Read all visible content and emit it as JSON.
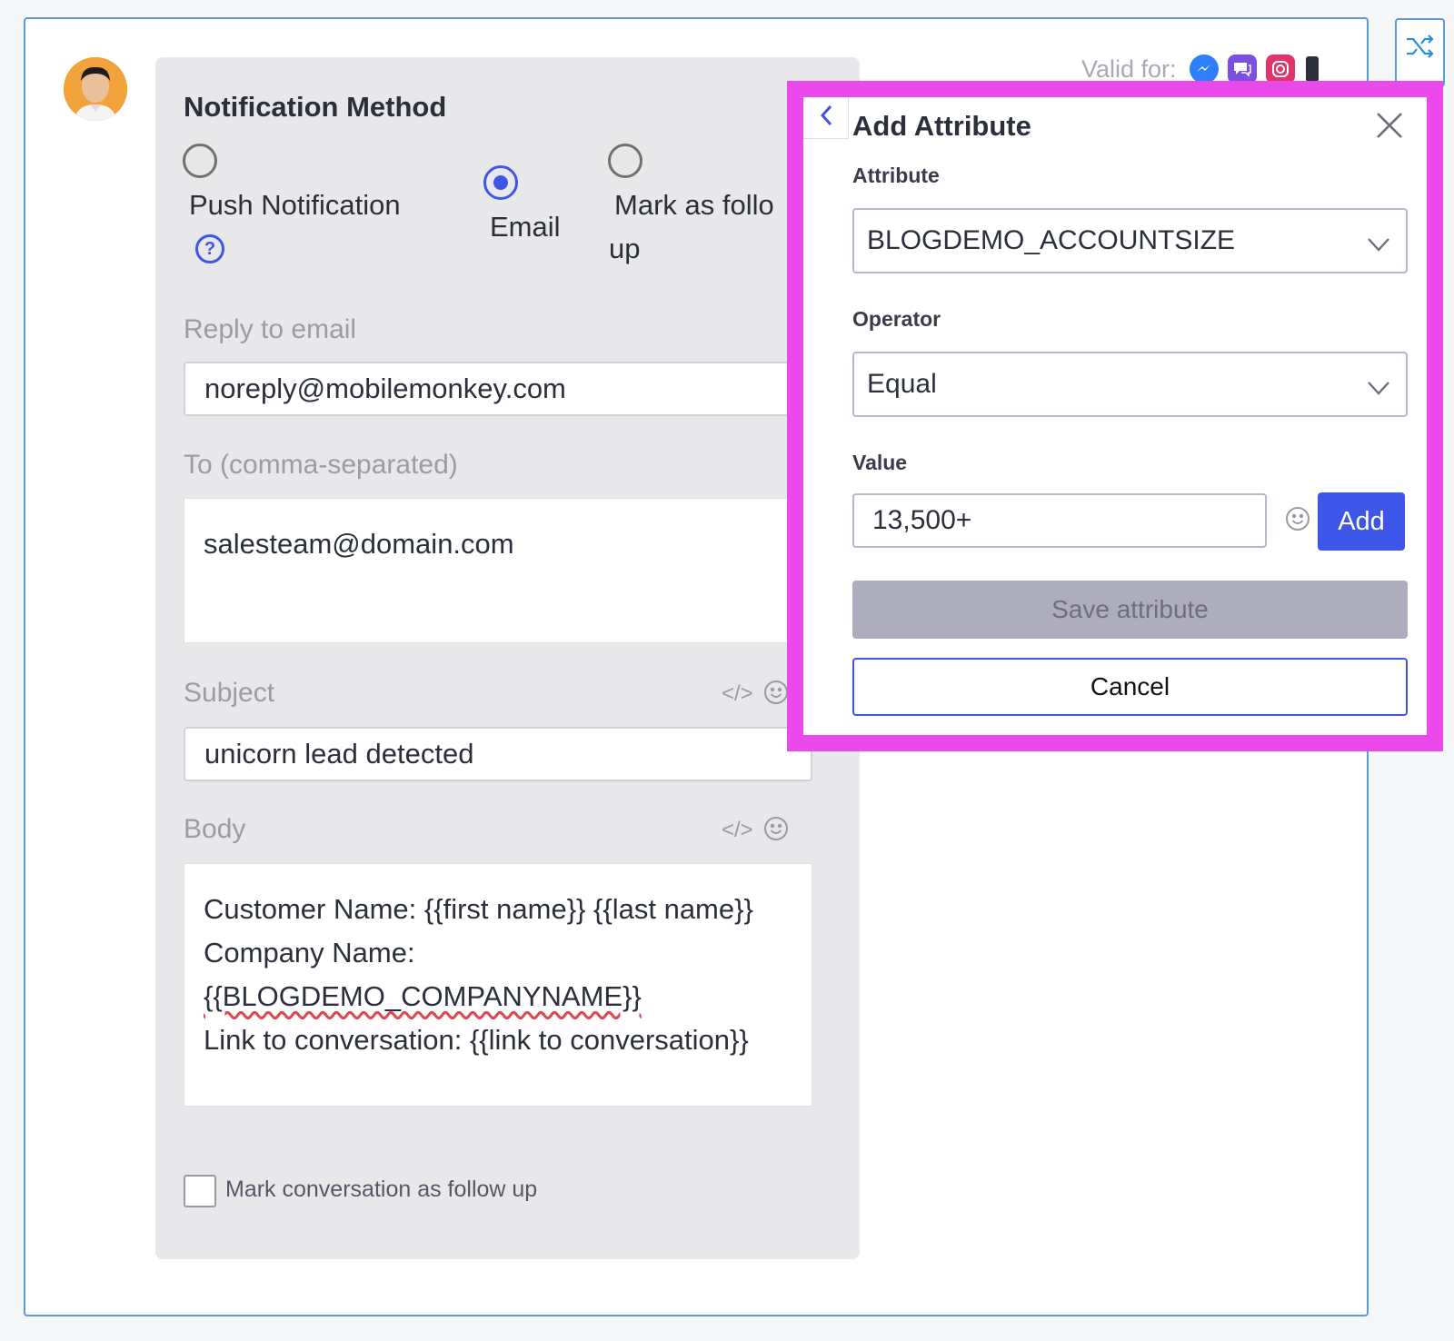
{
  "valid_for": {
    "label": "Valid for:",
    "channels": [
      "messenger-icon",
      "chat-icon",
      "instagram-icon",
      "phone-icon"
    ]
  },
  "notification": {
    "title": "Notification Method",
    "options": [
      {
        "label": "Push Notification",
        "checked": false
      },
      {
        "label": "Email",
        "checked": true
      },
      {
        "label_line1": "Mark as follo",
        "label_line2": "up",
        "checked": false
      }
    ]
  },
  "reply_to": {
    "label": "Reply to email",
    "value": "noreply@mobilemonkey.com"
  },
  "to": {
    "label": "To (comma-separated)",
    "value": "salesteam@domain.com"
  },
  "subject": {
    "label": "Subject",
    "value": "unicorn lead detected"
  },
  "body": {
    "label": "Body",
    "lines": [
      "Customer Name: {{first name}} {{last name}}",
      "Company Name:",
      "{{BLOGDEMO_COMPANYNAME}}",
      "Link to conversation: {{link to conversation}}"
    ],
    "code_icon": "</>"
  },
  "follow_up": {
    "label": "Mark conversation as follow up",
    "checked": false
  },
  "modal": {
    "title": "Add Attribute",
    "attribute_label": "Attribute",
    "attribute_value": "BLOGDEMO_ACCOUNTSIZE",
    "operator_label": "Operator",
    "operator_value": "Equal",
    "value_label": "Value",
    "value_input": "13,500+",
    "add_label": "Add",
    "save_label": "Save attribute",
    "cancel_label": "Cancel"
  },
  "colors": {
    "accent": "#3d56e8",
    "highlight": "#ec49ec",
    "frame": "#5b9bd5"
  }
}
